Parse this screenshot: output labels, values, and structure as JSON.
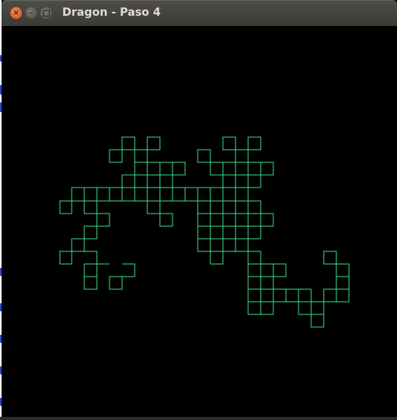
{
  "window": {
    "title": "Dragon - Paso 4",
    "buttons": {
      "close_icon": "close-icon",
      "minimize_icon": "minimize-icon",
      "maximize_icon": "maximize-icon"
    }
  },
  "canvas": {
    "background_color": "#000000",
    "line_color": "#3ddc84",
    "figure": "dragon-curve"
  }
}
